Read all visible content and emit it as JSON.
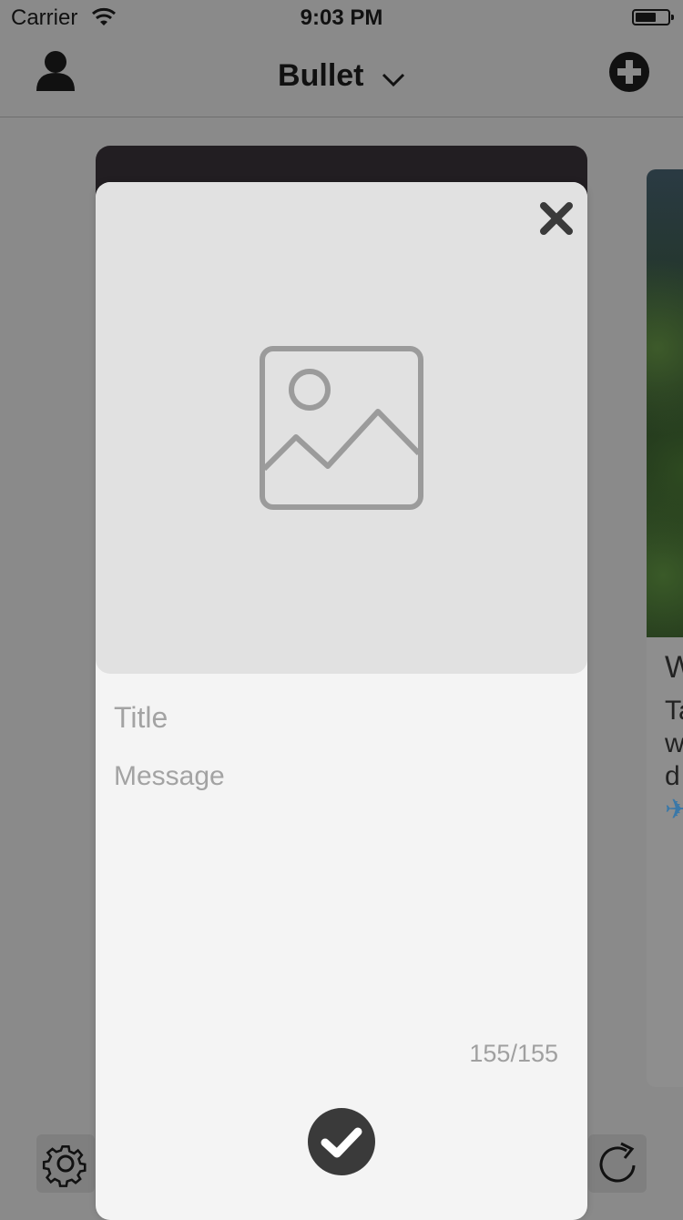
{
  "status_bar": {
    "carrier": "Carrier",
    "time": "9:03 PM"
  },
  "nav": {
    "title": "Bullet",
    "user_icon": "user-icon",
    "add_icon": "plus-circle-icon",
    "dropdown_icon": "chevron-down-icon"
  },
  "modal": {
    "title_placeholder": "Title",
    "message_placeholder": "Message",
    "char_count": "155/155",
    "close_icon": "close-icon",
    "image_icon": "image-placeholder-icon",
    "submit_icon": "checkmark-icon"
  },
  "background_card": {
    "heading": "W",
    "line1": "Ta",
    "line2": "w",
    "line3": "d",
    "line4": "✈"
  },
  "toolbar": {
    "settings_icon": "gear-icon",
    "refresh_icon": "refresh-icon"
  },
  "colors": {
    "overlay": "#8a8a8a",
    "modal_bg": "#f4f4f4",
    "image_area": "#e1e1e1",
    "icon_dark": "#3a3a3a"
  }
}
